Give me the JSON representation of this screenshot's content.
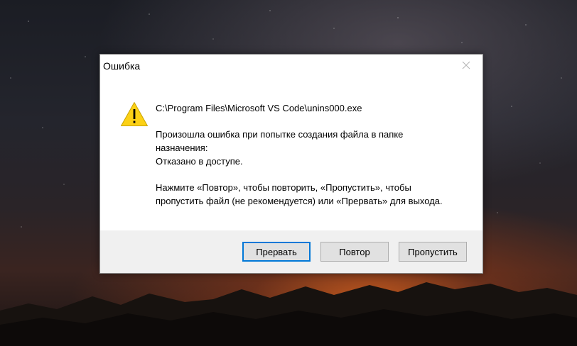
{
  "dialog": {
    "title": "Ошибка",
    "path": "C:\\Program Files\\Microsoft VS Code\\unins000.exe",
    "message": "Произошла ошибка при попытке создания файла в папке\nназначения:\nОтказано в доступе.",
    "instructions": "Нажмите «Повтор», чтобы повторить, «Пропустить», чтобы\nпропустить файл (не рекомендуется) или «Прервать» для выхода.",
    "icon": "warning-icon",
    "buttons": {
      "abort": "Прервать",
      "retry": "Повтор",
      "ignore": "Пропустить"
    }
  },
  "colors": {
    "accent": "#0078d7",
    "warning": "#fcd116"
  }
}
